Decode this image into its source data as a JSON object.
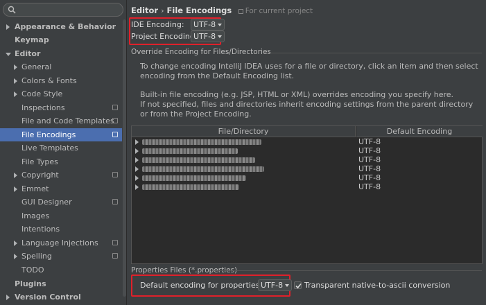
{
  "search": {
    "placeholder": ""
  },
  "sidebar": {
    "items": [
      {
        "label": "Appearance & Behavior"
      },
      {
        "label": "Keymap"
      },
      {
        "label": "Editor"
      },
      {
        "label": "General"
      },
      {
        "label": "Colors & Fonts"
      },
      {
        "label": "Code Style"
      },
      {
        "label": "Inspections"
      },
      {
        "label": "File and Code Templates"
      },
      {
        "label": "File Encodings"
      },
      {
        "label": "Live Templates"
      },
      {
        "label": "File Types"
      },
      {
        "label": "Copyright"
      },
      {
        "label": "Emmet"
      },
      {
        "label": "GUI Designer"
      },
      {
        "label": "Images"
      },
      {
        "label": "Intentions"
      },
      {
        "label": "Language Injections"
      },
      {
        "label": "Spelling"
      },
      {
        "label": "TODO"
      },
      {
        "label": "Plugins"
      },
      {
        "label": "Version Control"
      }
    ]
  },
  "breadcrumb": {
    "parent": "Editor",
    "separator": "›",
    "current": "File Encodings",
    "note": "For current project"
  },
  "ide_encoding": {
    "label": "IDE Encoding:",
    "value": "UTF-8"
  },
  "project_encoding": {
    "label": "Project Encoding:",
    "value": "UTF-8"
  },
  "override_section": {
    "title": "Override Encoding for Files/Directories"
  },
  "description": {
    "p1": "To change encoding IntelliJ IDEA uses for a file or directory, click an item and then select encoding from the Default Encoding list.",
    "p2": "Built-in file encoding (e.g. JSP, HTML or XML) overrides encoding you specify here.",
    "p3": "If not specified, files and directories inherit encoding settings from the parent directory or from the Project Encoding."
  },
  "table": {
    "headers": [
      "File/Directory",
      "Default Encoding"
    ],
    "rows": [
      {
        "encoding": "UTF-8"
      },
      {
        "encoding": "UTF-8"
      },
      {
        "encoding": "UTF-8"
      },
      {
        "encoding": "UTF-8"
      },
      {
        "encoding": "UTF-8"
      },
      {
        "encoding": "UTF-8"
      }
    ]
  },
  "properties_section": {
    "title": "Properties Files (*.properties)"
  },
  "properties": {
    "label": "Default encoding for properties files:",
    "value": "UTF-8",
    "transparent_label": "Transparent native-to-ascii conversion",
    "transparent_checked": true
  },
  "colors": {
    "selection": "#4b6eaf",
    "highlight": "#e0202a",
    "background": "#3c3f41"
  }
}
